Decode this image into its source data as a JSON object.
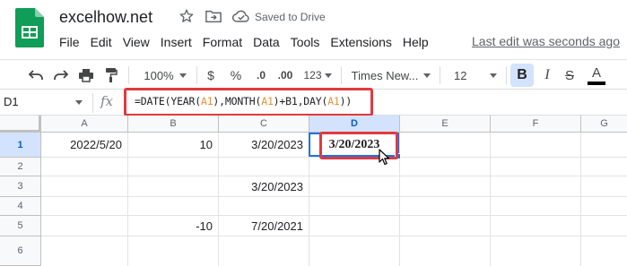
{
  "app": {
    "doc_title": "excelhow.net",
    "saved_status": "Saved to Drive",
    "last_edit": "Last edit was seconds ago",
    "menu": [
      "File",
      "Edit",
      "View",
      "Insert",
      "Format",
      "Data",
      "Tools",
      "Extensions",
      "Help"
    ]
  },
  "toolbar": {
    "zoom": "100%",
    "currency": "$",
    "percent": "%",
    "dec_decrease": ".0",
    "dec_increase": ".00",
    "more_formats": "123",
    "font": "Times New...",
    "font_size": "12",
    "bold": "B",
    "italic": "I",
    "strike": "S",
    "text_color": "A"
  },
  "formula_bar": {
    "name_box": "D1",
    "fx": "fx",
    "formula_parts": [
      "=DATE(YEAR(",
      "A1",
      "),MONTH(",
      "A1",
      ")+B1,DAY(",
      "A1",
      "))"
    ]
  },
  "grid": {
    "columns": [
      "A",
      "B",
      "C",
      "D",
      "E",
      "F",
      "G"
    ],
    "rows": [
      "1",
      "2",
      "3",
      "4",
      "5",
      "6"
    ],
    "cells": {
      "A1": "2022/5/20",
      "B1": "10",
      "C1": "3/20/2023",
      "D1": "3/20/2023",
      "C3": "3/20/2023",
      "B5": "-10",
      "C5": "7/20/2021"
    },
    "active_cell": "D1"
  },
  "colors": {
    "accent_blue": "#1a73e8",
    "highlight_red": "#e03a3e",
    "sheets_green": "#0f9d58",
    "ref_orange": "#e69138"
  }
}
